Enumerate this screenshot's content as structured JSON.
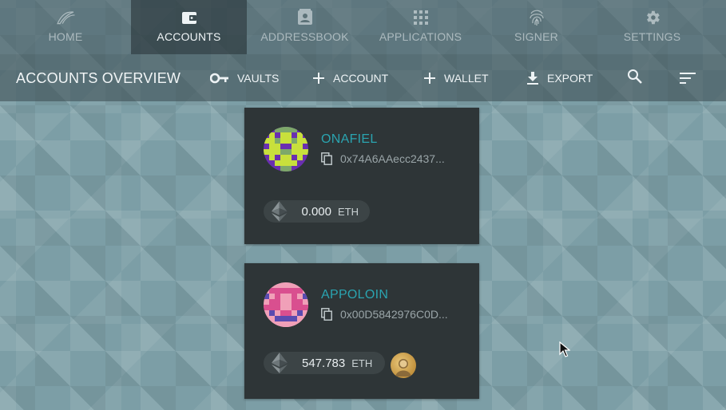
{
  "nav": {
    "items": [
      {
        "label": "HOME",
        "icon": "logo-icon",
        "active": false
      },
      {
        "label": "ACCOUNTS",
        "icon": "wallet-icon",
        "active": true
      },
      {
        "label": "ADDRESSBOOK",
        "icon": "contacts-icon",
        "active": false
      },
      {
        "label": "APPLICATIONS",
        "icon": "apps-grid-icon",
        "active": false
      },
      {
        "label": "SIGNER",
        "icon": "fingerprint-icon",
        "active": false
      },
      {
        "label": "SETTINGS",
        "icon": "gear-icon",
        "active": false
      }
    ]
  },
  "toolbar": {
    "title": "ACCOUNTS OVERVIEW",
    "vaults_label": "VAULTS",
    "account_label": "ACCOUNT",
    "wallet_label": "WALLET",
    "export_label": "EXPORT",
    "icons": [
      "key-icon",
      "plus-icon",
      "plus-icon",
      "download-icon",
      "search-icon",
      "sort-icon"
    ]
  },
  "accounts": [
    {
      "name": "ONAFIEL",
      "address": "0x74A6AAecc2437...",
      "balance": "0.000",
      "unit": "ETH",
      "avatar_colors": [
        "#c8e03c",
        "#6a2fb0",
        "#7da86a"
      ]
    },
    {
      "name": "APPOLOIN",
      "address": "0x00D5842976C0D...",
      "balance": "547.783",
      "unit": "ETH",
      "avatar_colors": [
        "#f0a0b8",
        "#d94f8f",
        "#5a4bb0"
      ]
    }
  ],
  "colors": {
    "accent": "#2aa4b0",
    "card_bg": "#2e3537",
    "page_bg": "#7c9ea6"
  }
}
